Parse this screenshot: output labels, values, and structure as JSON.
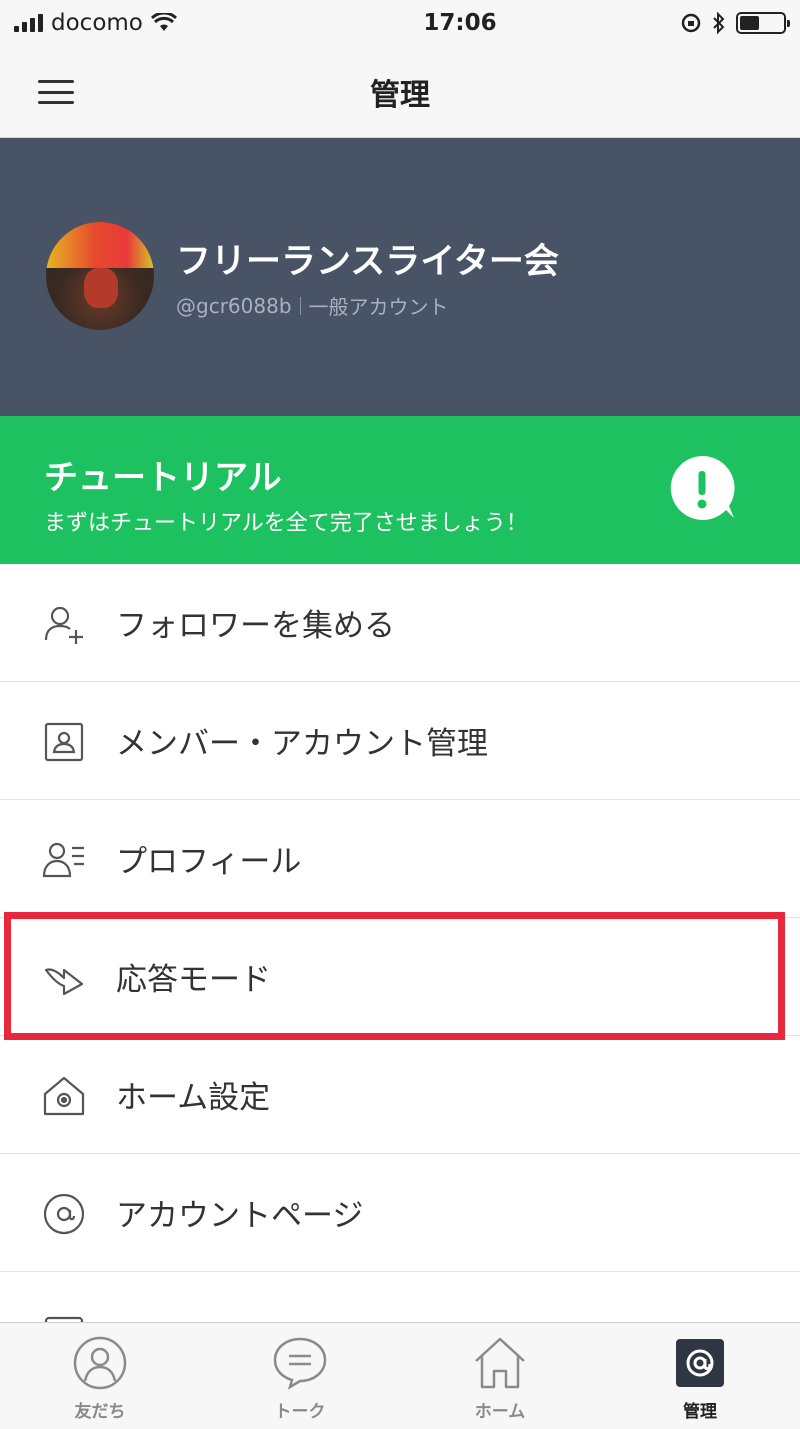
{
  "status_bar": {
    "carrier": "docomo",
    "time": "17:06"
  },
  "nav_bar": {
    "title": "管理"
  },
  "account": {
    "name": "フリーランスライター会",
    "id": "@gcr6088b",
    "type": "一般アカウント"
  },
  "tutorial": {
    "title": "チュートリアル",
    "description": "まずはチュートリアルを全て完了させましょう！",
    "color": "#1dc160"
  },
  "menu_items": [
    {
      "label": "フォロワーを集める",
      "icon": "add-person-icon"
    },
    {
      "label": "メンバー・アカウント管理",
      "icon": "member-card-icon"
    },
    {
      "label": "プロフィール",
      "icon": "profile-list-icon"
    },
    {
      "label": "応答モード",
      "icon": "reply-arrow-icon",
      "highlighted": true
    },
    {
      "label": "ホーム設定",
      "icon": "home-settings-icon"
    },
    {
      "label": "アカウントページ",
      "icon": "account-page-icon"
    }
  ],
  "tab_bar": {
    "tabs": [
      {
        "label": "友だち",
        "icon": "friends-icon"
      },
      {
        "label": "トーク",
        "icon": "talk-icon"
      },
      {
        "label": "ホーム",
        "icon": "home-icon"
      },
      {
        "label": "管理",
        "icon": "manage-icon",
        "active": true
      }
    ]
  },
  "colors": {
    "header_bg": "#495366",
    "highlight": "#e8283c"
  }
}
